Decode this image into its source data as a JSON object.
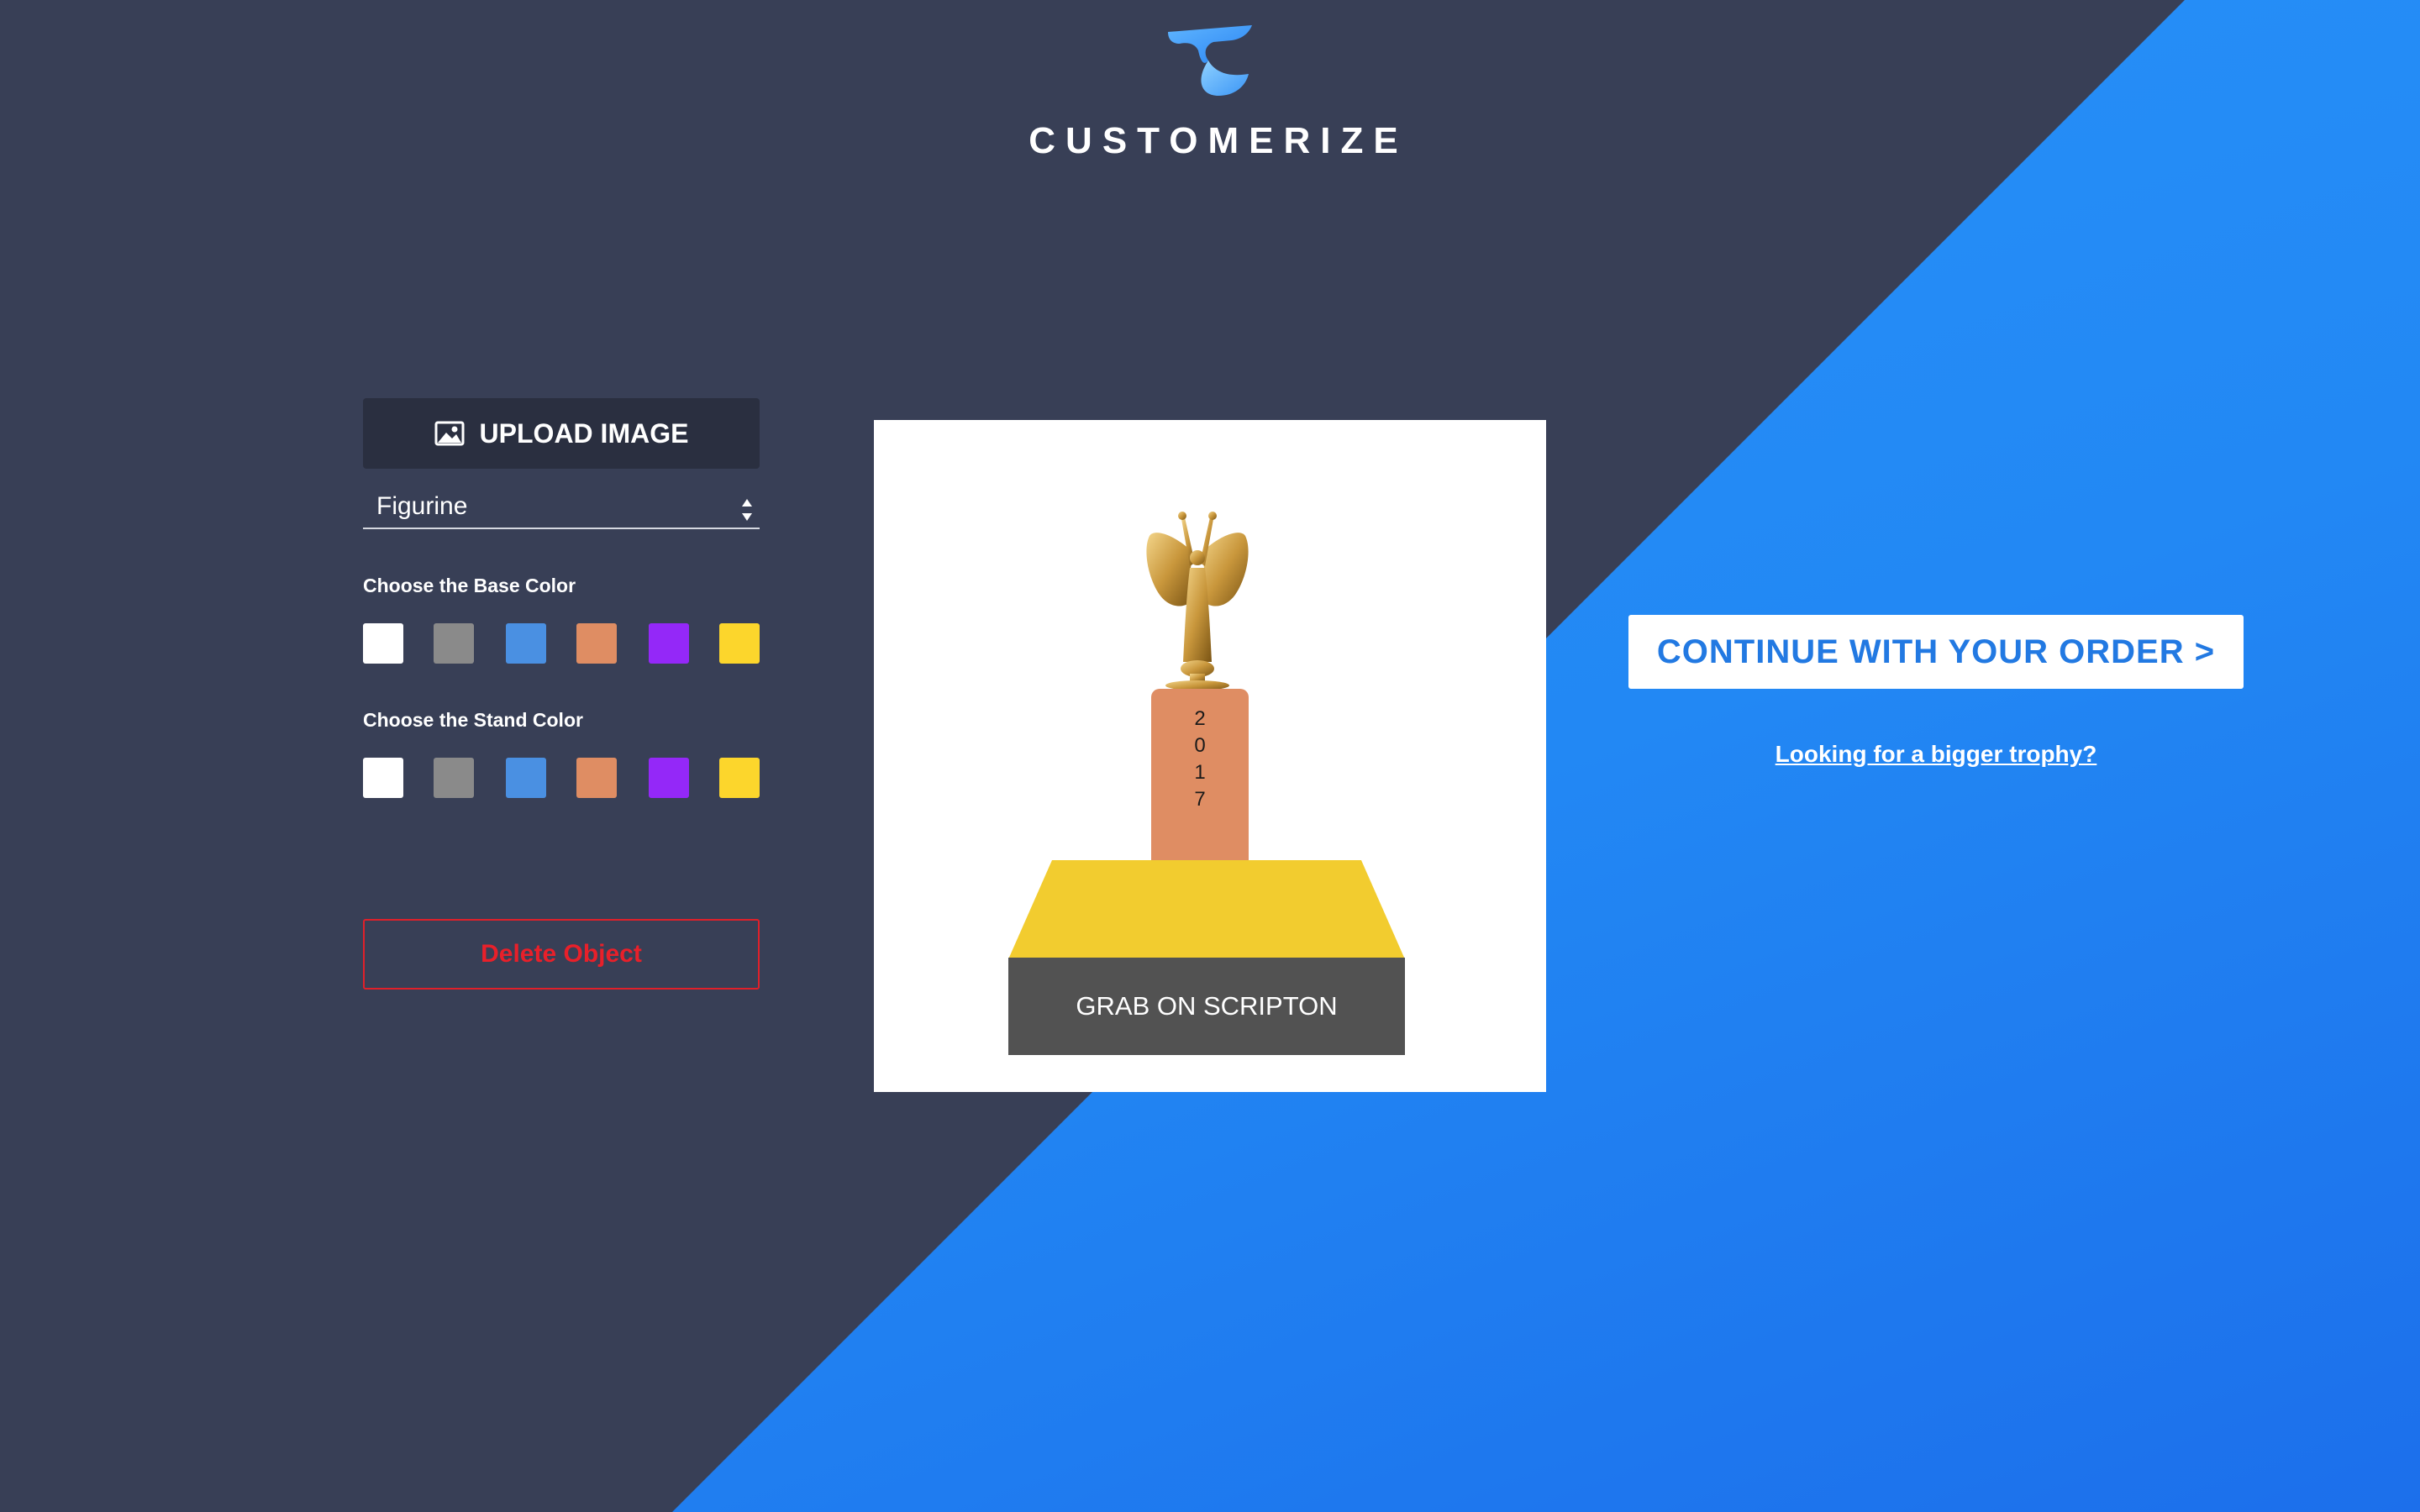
{
  "header": {
    "brand": "CUSTOMERIZE",
    "logo_icon": "customerize-c-logo-icon"
  },
  "left_panel": {
    "upload_label": "UPLOAD IMAGE",
    "upload_icon": "image-icon",
    "figure_select": {
      "selected": "Figurine",
      "icon": "select-arrows-icon"
    },
    "base_color_label": "Choose the Base Color",
    "stand_color_label": "Choose the Stand Color",
    "swatch_colors": [
      "#ffffff",
      "#8a8a8a",
      "#4a90e2",
      "#df8d63",
      "#9428f8",
      "#fcd62c"
    ],
    "delete_label": "Delete Object"
  },
  "canvas": {
    "stand_text": [
      "2",
      "0",
      "1",
      "7"
    ],
    "plate_text": "GRAB ON SCRIPTON",
    "figurine": "winged-victory-figurine",
    "colors": {
      "stand": "#df8d63",
      "base": "#f2cc2f",
      "plate": "#525252"
    }
  },
  "right_panel": {
    "continue_label": "CONTINUE WITH YOUR ORDER >",
    "bigger_link": "Looking for a bigger trophy?"
  },
  "theme": {
    "dark_bg": "#383f56",
    "blue_bg": "#2288f4",
    "accent": "#2279e2",
    "danger": "#e8202a"
  }
}
